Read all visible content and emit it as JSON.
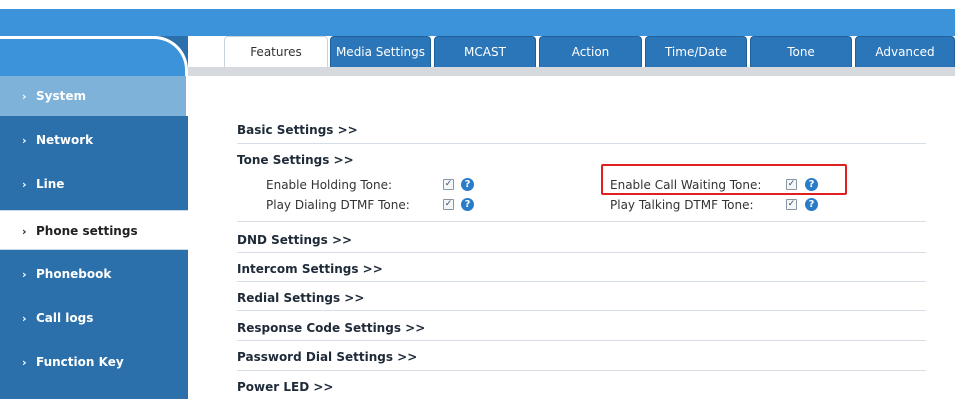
{
  "sidebar": {
    "items": [
      {
        "label": "System"
      },
      {
        "label": "Network"
      },
      {
        "label": "Line"
      },
      {
        "label": "Phone settings"
      },
      {
        "label": "Phonebook"
      },
      {
        "label": "Call logs"
      },
      {
        "label": "Function Key"
      }
    ],
    "chevron": "›",
    "active": "Phone settings"
  },
  "tabs": [
    {
      "label": "Features"
    },
    {
      "label": "Media Settings"
    },
    {
      "label": "MCAST"
    },
    {
      "label": "Action"
    },
    {
      "label": "Time/Date"
    },
    {
      "label": "Tone"
    },
    {
      "label": "Advanced"
    }
  ],
  "active_tab": "Features",
  "sections": {
    "basic": "Basic Settings >>",
    "tone": "Tone Settings >>",
    "dnd": "DND Settings >>",
    "intercom": "Intercom Settings >>",
    "redial": "Redial Settings >>",
    "response_code": "Response Code Settings >>",
    "password_dial": "Password Dial Settings >>",
    "power_led": "Power LED >>"
  },
  "tone_settings": {
    "enable_holding_tone": {
      "label": "Enable Holding Tone:",
      "checked": true
    },
    "play_dialing_dtmf_tone": {
      "label": "Play Dialing DTMF Tone:",
      "checked": true
    },
    "enable_call_waiting_tone": {
      "label": "Enable Call Waiting Tone:",
      "checked": true
    },
    "play_talking_dtmf_tone": {
      "label": "Play Talking DTMF Tone:",
      "checked": true
    }
  },
  "icons": {
    "help": "help-icon",
    "checkmark": "✓",
    "help_glyph": "?"
  },
  "colors": {
    "header_blue": "#3c93d9",
    "sidebar_blue": "#2b6fab",
    "tab_blue": "#2b76b9",
    "highlight_red": "#e02020"
  }
}
